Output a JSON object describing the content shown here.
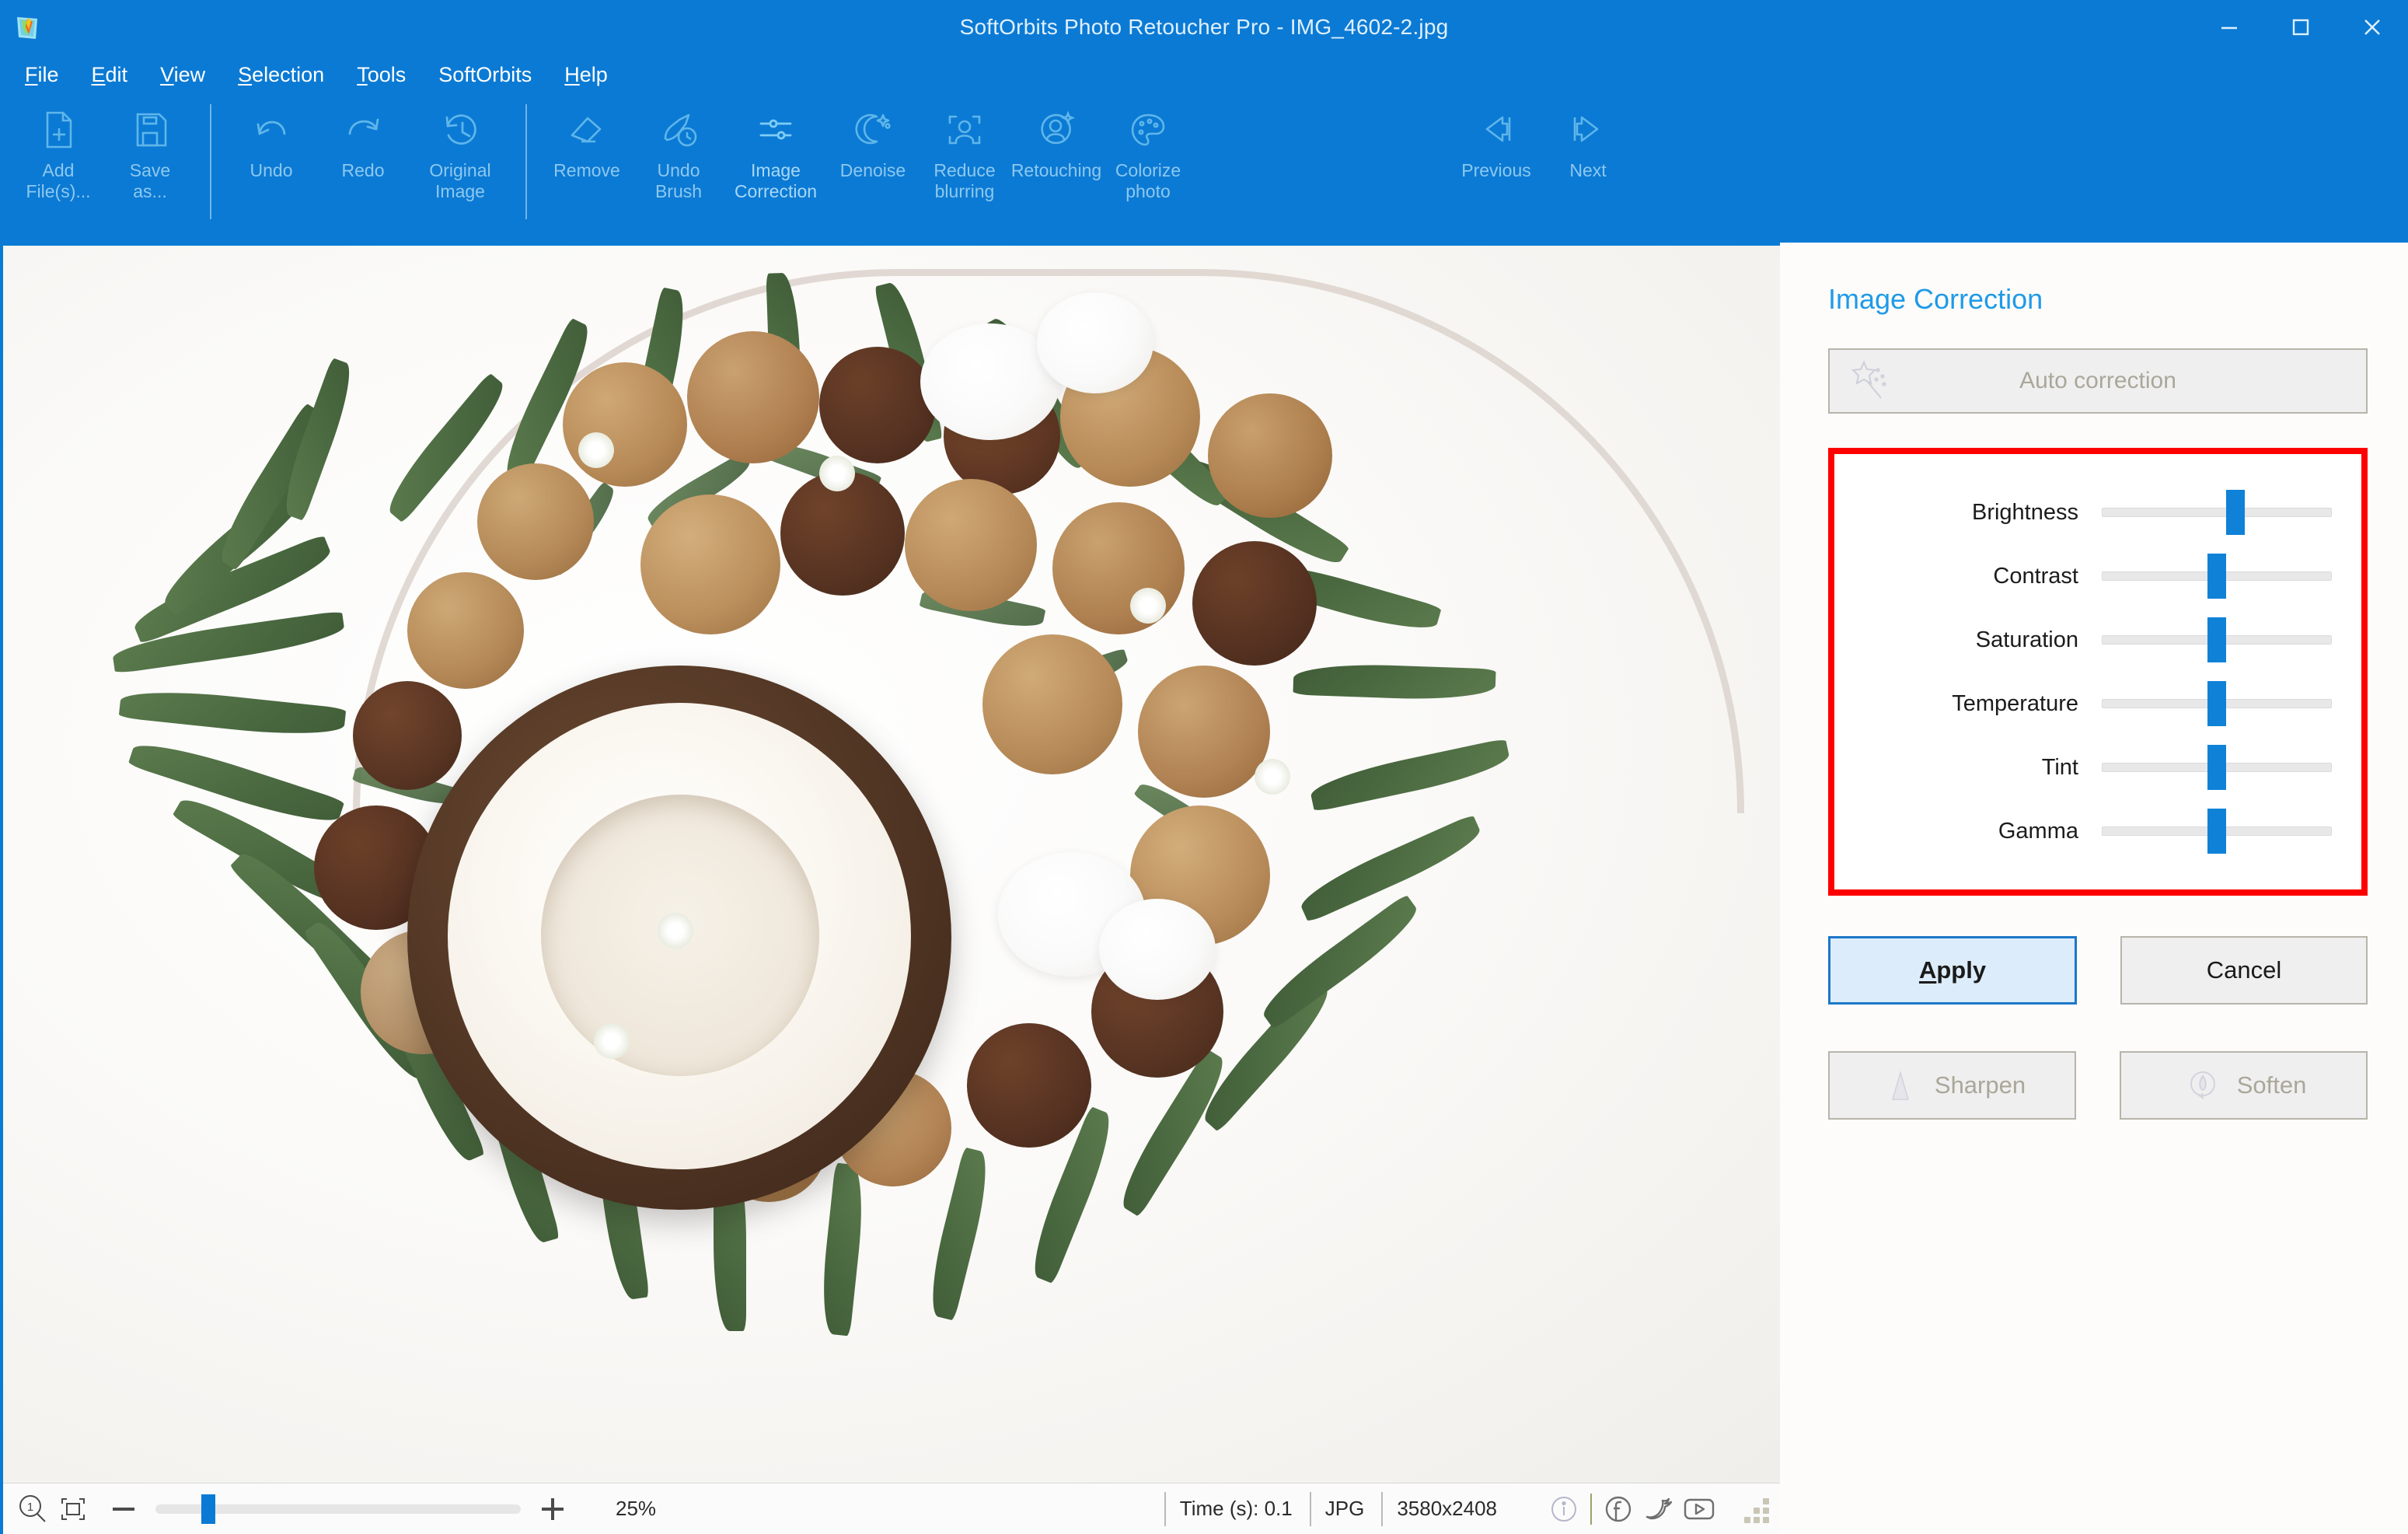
{
  "window": {
    "title": "SoftOrbits Photo Retoucher Pro - IMG_4602-2.jpg",
    "app_icon": "softorbits-logo-icon",
    "minimize_label": "Minimize",
    "maximize_label": "Maximize",
    "close_label": "Close"
  },
  "menu": {
    "items": [
      {
        "label": "File",
        "accel": "F",
        "rest": "ile"
      },
      {
        "label": "Edit",
        "accel": "E",
        "rest": "dit"
      },
      {
        "label": "View",
        "accel": "V",
        "rest": "iew"
      },
      {
        "label": "Selection",
        "accel": "S",
        "rest": "election"
      },
      {
        "label": "Tools",
        "accel": "T",
        "rest": "ools"
      },
      {
        "label": "SoftOrbits",
        "accel": "",
        "rest": "SoftOrbits"
      },
      {
        "label": "Help",
        "accel": "H",
        "rest": "elp"
      }
    ]
  },
  "toolbar": {
    "groups": [
      {
        "buttons": [
          {
            "label_line1": "Add",
            "label_line2": "File(s)...",
            "icon": "add-file-icon",
            "disabled": true
          },
          {
            "label_line1": "Save",
            "label_line2": "as...",
            "icon": "save-as-icon",
            "disabled": true
          }
        ]
      },
      {
        "buttons": [
          {
            "label_line1": "Undo",
            "label_line2": "",
            "icon": "undo-arrow-icon",
            "disabled": true
          },
          {
            "label_line1": "Redo",
            "label_line2": "",
            "icon": "redo-arrow-icon",
            "disabled": true
          },
          {
            "label_line1": "Original",
            "label_line2": "Image",
            "icon": "history-clock-icon",
            "disabled": true
          }
        ]
      },
      {
        "buttons": [
          {
            "label_line1": "Remove",
            "label_line2": "",
            "icon": "eraser-icon",
            "disabled": true
          },
          {
            "label_line1": "Undo",
            "label_line2": "Brush",
            "icon": "undo-brush-icon",
            "disabled": true
          },
          {
            "label_line1": "Image",
            "label_line2": "Correction",
            "icon": "sliders-icon",
            "disabled": false
          },
          {
            "label_line1": "Denoise",
            "label_line2": "",
            "icon": "moon-stars-icon",
            "disabled": true
          },
          {
            "label_line1": "Reduce",
            "label_line2": "blurring",
            "icon": "focus-person-icon",
            "disabled": true
          },
          {
            "label_line1": "Retouching",
            "label_line2": "",
            "icon": "person-sparkle-icon",
            "disabled": true
          },
          {
            "label_line1": "Colorize",
            "label_line2": "photo",
            "icon": "palette-icon",
            "disabled": true
          }
        ]
      },
      {
        "buttons": [
          {
            "label_line1": "Previous",
            "label_line2": "",
            "icon": "arrow-left-icon",
            "disabled": true
          },
          {
            "label_line1": "Next",
            "label_line2": "",
            "icon": "arrow-right-icon",
            "disabled": true
          }
        ]
      }
    ]
  },
  "panel": {
    "title": "Image Correction",
    "auto_correction": {
      "label": "Auto correction",
      "icon": "magic-wand-icon",
      "disabled": true
    },
    "sliders": [
      {
        "label": "Brightness",
        "value": 58
      },
      {
        "label": "Contrast",
        "value": 50
      },
      {
        "label": "Saturation",
        "value": 50
      },
      {
        "label": "Temperature",
        "value": 50
      },
      {
        "label": "Tint",
        "value": 50
      },
      {
        "label": "Gamma",
        "value": 50
      }
    ],
    "highlight_color": "#ff0000",
    "accent_color": "#1f9ae8",
    "buttons": {
      "apply": {
        "accel": "A",
        "rest": "pply",
        "label": "Apply",
        "primary": true
      },
      "cancel": {
        "label": "Cancel"
      },
      "sharpen": {
        "label": "Sharpen",
        "icon": "sharpen-triangle-icon",
        "disabled": true
      },
      "soften": {
        "label": "Soften",
        "icon": "soften-droplet-icon",
        "disabled": true
      }
    }
  },
  "statusbar": {
    "zoom_one_to_one_icon": "zoom-1-to-1-icon",
    "fit_icon": "fit-to-window-icon",
    "minus_icon": "zoom-out-icon",
    "plus_icon": "zoom-in-icon",
    "zoom_value": "25%",
    "zoom_slider_position": 12.5,
    "time": "Time (s): 0.1",
    "format": "JPG",
    "dimensions": "3580x2408",
    "info_icon": "info-icon",
    "facebook_icon": "facebook-icon",
    "twitter_icon": "twitter-icon",
    "youtube_icon": "youtube-icon"
  }
}
